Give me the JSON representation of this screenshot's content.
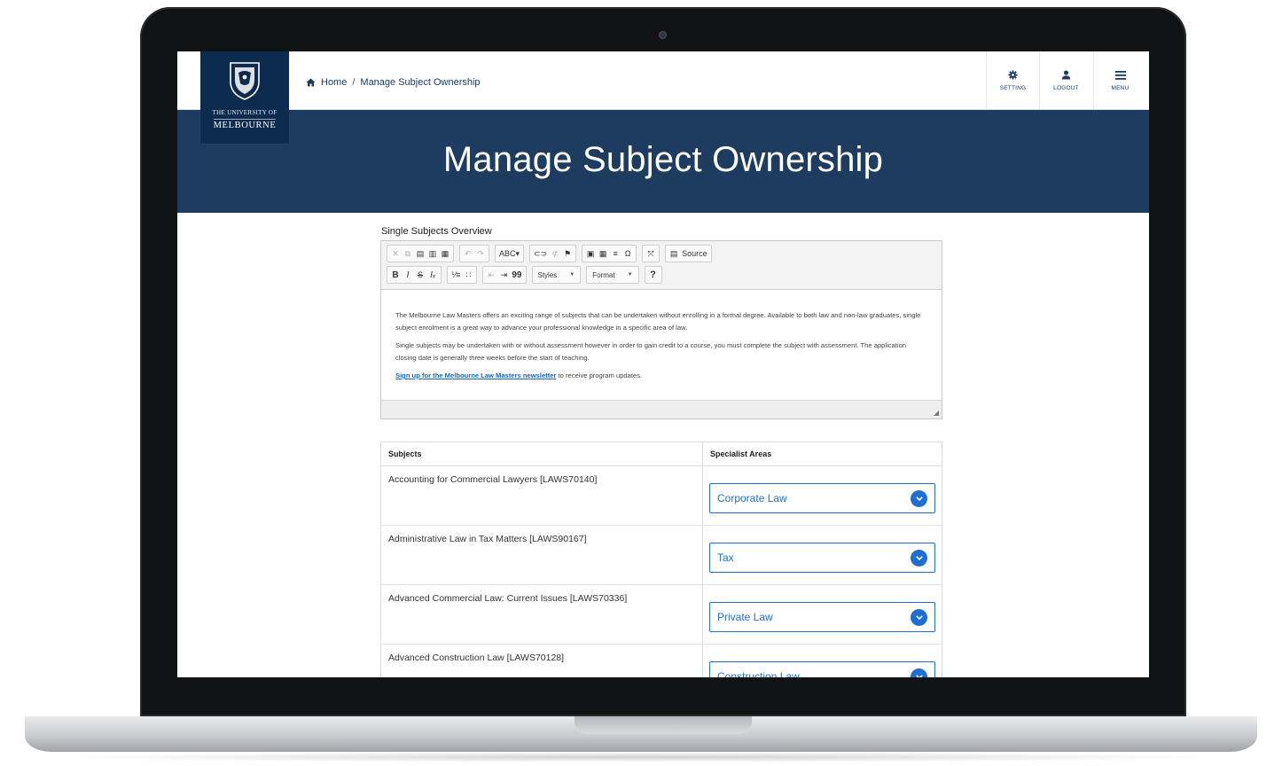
{
  "breadcrumb": {
    "home": "Home",
    "separator": "/",
    "current": "Manage Subject Ownership"
  },
  "logo": {
    "line1": "THE UNIVERSITY OF",
    "line2": "MELBOURNE"
  },
  "nav": [
    {
      "label": "SETTING",
      "icon": "gear-icon"
    },
    {
      "label": "LOGOUT",
      "icon": "user-icon"
    },
    {
      "label": "MENU",
      "icon": "hamburger-icon"
    }
  ],
  "hero": {
    "title": "Manage Subject Ownership"
  },
  "editor": {
    "section_title": "Single Subjects Overview",
    "source_label": "Source",
    "styles_label": "Styles",
    "format_label": "Format",
    "help_label": "?",
    "paragraph1": "The Melbourne Law Masters offers an exciting range of subjects that can be undertaken without enrolling in a formal degree. Available to both law and non-law graduates, single subject enrolment is a great way to advance your professional knowledge in a specific area of law.",
    "paragraph2": "Single subjects may be undertaken with or without assessment however in order to gain credit to a course, you must complete the subject with assessment. The application closing date is generally three weeks before the start of teaching.",
    "link_text": "Sign up for the Melbourne Law Masters newsletter",
    "link_suffix": " to receive program updates."
  },
  "table": {
    "headers": [
      "Subjects",
      "Specialist Areas"
    ],
    "rows": [
      {
        "subject": "Accounting for Commercial Lawyers [LAWS70140]",
        "area": "Corporate Law"
      },
      {
        "subject": "Administrative Law in Tax Matters [LAWS90167]",
        "area": "Tax"
      },
      {
        "subject": "Advanced Commercial Law: Current Issues [LAWS70336]",
        "area": "Private Law"
      },
      {
        "subject": "Advanced Construction Law [LAWS70128]",
        "area": "Construction Law"
      }
    ]
  },
  "colors": {
    "navy": "#0d2b4e",
    "hero": "#1d3c5f",
    "accent": "#1e6fd0"
  }
}
